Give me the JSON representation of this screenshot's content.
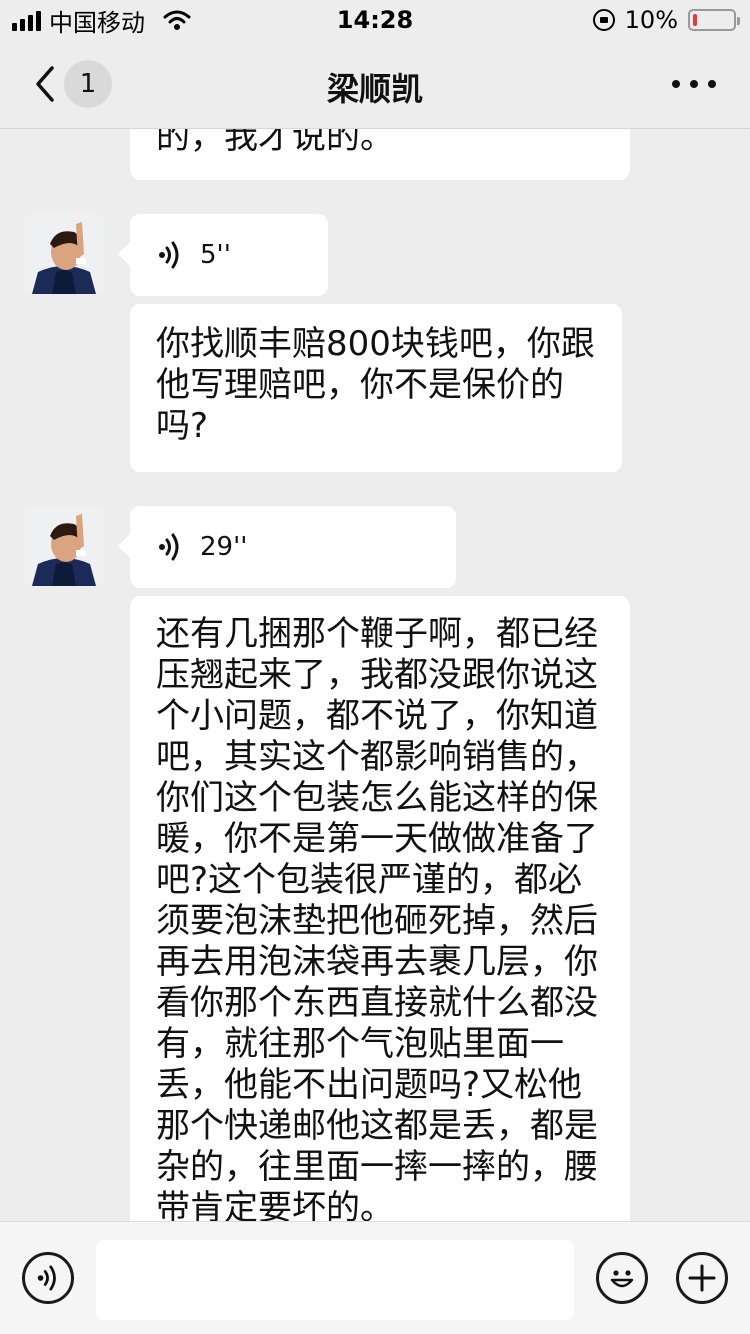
{
  "status_bar": {
    "carrier": "中国移动",
    "time": "14:28",
    "battery_percent": "10%",
    "battery_level": 0.1,
    "battery_color": "#e53935"
  },
  "nav": {
    "back_icon": "chevron-left-icon",
    "unread_count": "1",
    "title": "梁顺凯",
    "more_icon": "more-dots-icon"
  },
  "messages": [
    {
      "type": "text",
      "sender": "contact",
      "text": "的，我才说的。"
    },
    {
      "type": "voice",
      "sender": "contact",
      "duration": "5''"
    },
    {
      "type": "text",
      "sender": "contact",
      "lines": [
        "你找顺丰赔800块钱吧，你跟",
        "他写理赔吧，你不是保价的",
        "吗?"
      ]
    },
    {
      "type": "voice",
      "sender": "contact",
      "duration": "29''"
    },
    {
      "type": "text",
      "sender": "contact",
      "lines": [
        "还有几捆那个鞭子啊，都已经",
        "压翘起来了，我都没跟你说这",
        "个小问题，都不说了，你知道",
        "吧，其实这个都影响销售的，",
        "你们这个包装怎么能这样的保",
        "暖，你不是第一天做做准备了",
        "吧?这个包装很严谨的，都必",
        "须要泡沫垫把他砸死掉，然后",
        "再去用泡沫袋再去裹几层，你",
        "看你那个东西直接就什么都没",
        "有，就往那个气泡贴里面一",
        "丢，他能不出问题吗?又松他",
        "那个快递邮他这都是丢，都是",
        "杂的，往里面一摔一摔的，腰",
        "带肯定要坏的。"
      ]
    }
  ],
  "input_bar": {
    "voice_icon": "voice-input-icon",
    "input_value": "",
    "emoji_icon": "emoji-smile-icon",
    "plus_icon": "plus-icon"
  },
  "colors": {
    "background": "#ededed",
    "bubble": "#ffffff",
    "text": "#111111"
  }
}
